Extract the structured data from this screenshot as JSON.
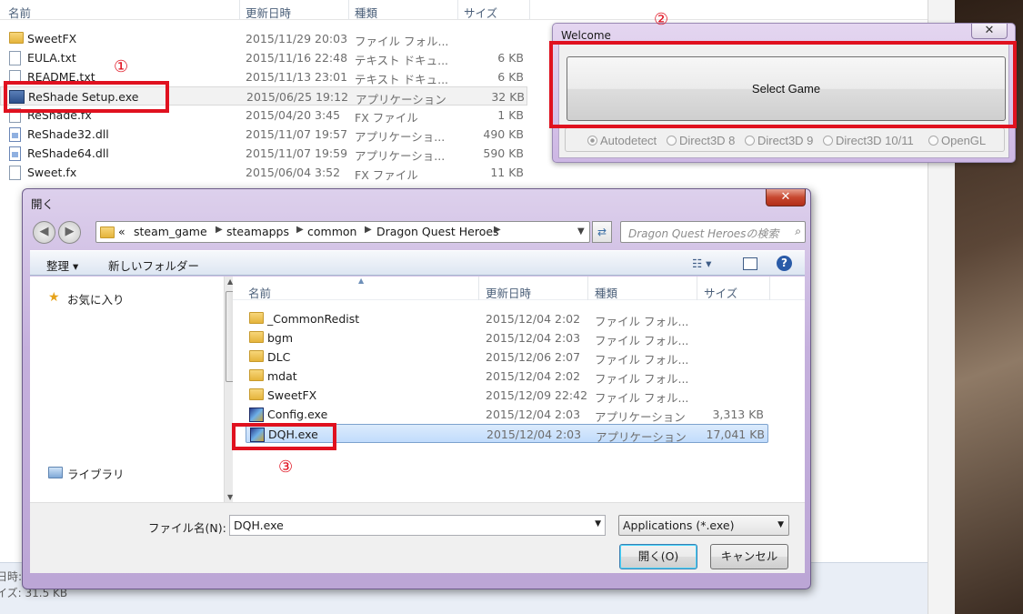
{
  "bg_explorer": {
    "columns": [
      "名前",
      "更新日時",
      "種類",
      "サイズ"
    ],
    "files": [
      {
        "name": "SweetFX",
        "date": "2015/11/29 20:03",
        "type": "ファイル フォル...",
        "size": "",
        "icon": "folder-icon"
      },
      {
        "name": "EULA.txt",
        "date": "2015/11/16 22:48",
        "type": "テキスト ドキュ...",
        "size": "6 KB",
        "icon": "text-file-icon"
      },
      {
        "name": "README.txt",
        "date": "2015/11/13 23:01",
        "type": "テキスト ドキュ...",
        "size": "6 KB",
        "icon": "text-file-icon"
      },
      {
        "name": "ReShade Setup.exe",
        "date": "2015/06/25 19:12",
        "type": "アプリケーション",
        "size": "32 KB",
        "icon": "application-icon"
      },
      {
        "name": "ReShade.fx",
        "date": "2015/04/20 3:45",
        "type": "FX ファイル",
        "size": "1 KB",
        "icon": "file-icon"
      },
      {
        "name": "ReShade32.dll",
        "date": "2015/11/07 19:57",
        "type": "アプリケーショ...",
        "size": "490 KB",
        "icon": "dll-icon"
      },
      {
        "name": "ReShade64.dll",
        "date": "2015/11/07 19:59",
        "type": "アプリケーショ...",
        "size": "590 KB",
        "icon": "dll-icon"
      },
      {
        "name": "Sweet.fx",
        "date": "2015/06/04 3:52",
        "type": "FX ファイル",
        "size": "11 KB",
        "icon": "file-icon"
      }
    ],
    "status_line1": "日時:",
    "status_line2": "イズ: 31.5 KB"
  },
  "welcome": {
    "title": "Welcome",
    "close": "✕",
    "select_game": "Select Game",
    "apis": [
      "Autodetect",
      "Direct3D 8",
      "Direct3D 9",
      "Direct3D 10/11",
      "OpenGL"
    ],
    "selected_api": "Autodetect"
  },
  "dialog": {
    "title": "開く",
    "close": "✕",
    "breadcrumb_lead": "«",
    "breadcrumbs": [
      "steam_game",
      "steamapps",
      "common",
      "Dragon Quest Heroes"
    ],
    "search_placeholder": "Dragon Quest Heroesの検索",
    "toolbar": {
      "organize": "整理 ▾",
      "new_folder": "新しいフォルダー"
    },
    "nav": {
      "favorites": "お気に入り",
      "libraries": "ライブラリ"
    },
    "columns": [
      "名前",
      "更新日時",
      "種類",
      "サイズ"
    ],
    "files": [
      {
        "name": "_CommonRedist",
        "date": "2015/12/04 2:02",
        "type": "ファイル フォル...",
        "size": "",
        "icon": "folder-icon"
      },
      {
        "name": "bgm",
        "date": "2015/12/04 2:03",
        "type": "ファイル フォル...",
        "size": "",
        "icon": "folder-icon"
      },
      {
        "name": "DLC",
        "date": "2015/12/06 2:07",
        "type": "ファイル フォル...",
        "size": "",
        "icon": "folder-icon"
      },
      {
        "name": "mdat",
        "date": "2015/12/04 2:02",
        "type": "ファイル フォル...",
        "size": "",
        "icon": "folder-icon"
      },
      {
        "name": "SweetFX",
        "date": "2015/12/09 22:42",
        "type": "ファイル フォル...",
        "size": "",
        "icon": "folder-icon"
      },
      {
        "name": "Config.exe",
        "date": "2015/12/04 2:03",
        "type": "アプリケーション",
        "size": "3,313 KB",
        "icon": "game-exe-icon"
      },
      {
        "name": "DQH.exe",
        "date": "2015/12/04 2:03",
        "type": "アプリケーション",
        "size": "17,041 KB",
        "icon": "game-exe-icon"
      }
    ],
    "filename_label": "ファイル名(N):",
    "filename_value": "DQH.exe",
    "filter": "Applications (*.exe)",
    "open_button": "開く(O)",
    "cancel_button": "キャンセル"
  },
  "annotations": [
    "①",
    "②",
    "③"
  ],
  "colors": {
    "annotation": "#e0111f",
    "selection": "#c1dcfc"
  }
}
